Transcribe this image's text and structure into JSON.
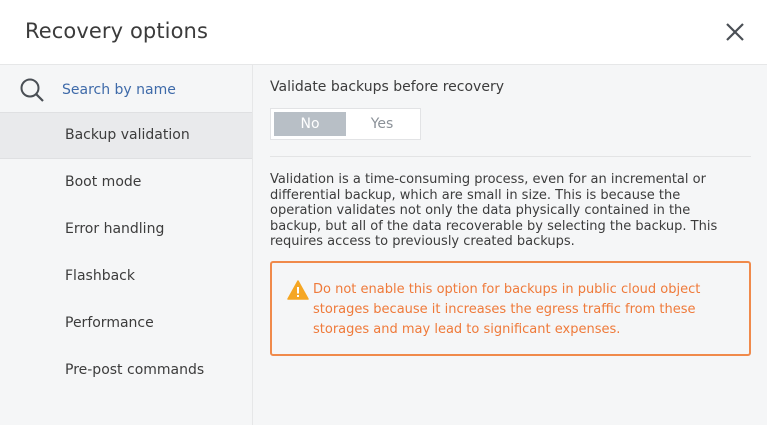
{
  "dialog": {
    "title": "Recovery options",
    "close_icon": "close-icon"
  },
  "sidebar": {
    "search": {
      "placeholder": "Search by name",
      "value": "",
      "icon": "search-icon"
    },
    "items": [
      {
        "label": "Backup validation",
        "active": true
      },
      {
        "label": "Boot mode",
        "active": false
      },
      {
        "label": "Error handling",
        "active": false
      },
      {
        "label": "Flashback",
        "active": false
      },
      {
        "label": "Performance",
        "active": false
      },
      {
        "label": "Pre-post commands",
        "active": false
      }
    ]
  },
  "main": {
    "option_label": "Validate backups before recovery",
    "toggle": {
      "no_label": "No",
      "yes_label": "Yes",
      "selected": "No"
    },
    "description": "Validation is a time-consuming process, even for an incremental or differential backup, which are small in size. This is because the operation validates not only the data physically contained in the backup, but all of the data recoverable by selecting the backup. This requires access to previously created backups.",
    "warning": {
      "icon": "warning-icon",
      "text": "Do not enable this option for backups in public cloud object storages because it increases the egress traffic from these storages and may lead to significant expenses."
    }
  },
  "colors": {
    "accent_link": "#3e6aa9",
    "warning": "#f08a4b",
    "toggle_selected": "#b8bfc6"
  }
}
